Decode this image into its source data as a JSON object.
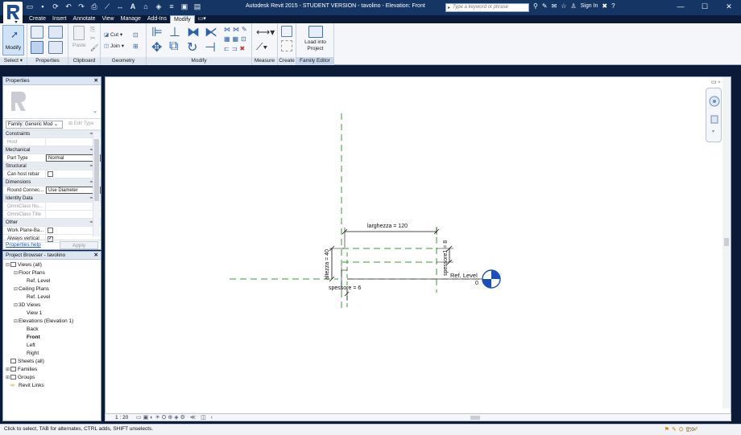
{
  "window": {
    "title": "Autodesk Revit 2015 - STUDENT VERSION -     tavolino - Elevation: Front",
    "search_placeholder": "Type a keyword or phrase",
    "signin_label": "Sign In",
    "controls": [
      "—",
      "☐",
      "✕"
    ]
  },
  "qat_icons": [
    "open-icon",
    "save-icon",
    "sync-icon",
    "undo-icon",
    "redo-icon",
    "print-icon",
    "measure-icon",
    "dimension-icon",
    "text-icon",
    "3d-view-icon",
    "section-icon",
    "thin-lines-icon",
    "close-hidden-icon",
    "switch-windows-icon"
  ],
  "ribbon": {
    "tabs": [
      "Create",
      "Insert",
      "Annotate",
      "View",
      "Manage",
      "Add-Ins",
      "Modify"
    ],
    "active_tab": "Modify",
    "modify_button": "Modify",
    "cut_label": "Cut",
    "join_label": "Join",
    "paste_label": "Paste",
    "load_into_project_label": "Load into Project",
    "panels": [
      "Select",
      "Properties",
      "Clipboard",
      "Geometry",
      "Modify",
      "Measure",
      "Create",
      "Family Editor"
    ]
  },
  "properties": {
    "title": "Properties",
    "family_select": "Family: Generic Mod",
    "edit_type_label": "Edit Type",
    "rows": [
      {
        "group": "Constraints"
      },
      {
        "k": "Host",
        "v": "",
        "dim": true
      },
      {
        "group": "Mechanical"
      },
      {
        "k": "Part Type",
        "v": "Normal"
      },
      {
        "group": "Structural"
      },
      {
        "k": "Can host rebar",
        "v": "",
        "check": true
      },
      {
        "group": "Dimensions"
      },
      {
        "k": "Round Connec...",
        "v": "Use Diameter"
      },
      {
        "group": "Identity Data"
      },
      {
        "k": "OmniClass Nu...",
        "v": "",
        "dim": true
      },
      {
        "k": "OmniClass Title",
        "v": "",
        "dim": true
      },
      {
        "group": "Other"
      },
      {
        "k": "Work Plane-Ba...",
        "v": "",
        "check": true
      },
      {
        "k": "Always vertical",
        "v": "",
        "check": true,
        "checked": true
      }
    ],
    "help_label": "Properties help",
    "apply_label": "Apply"
  },
  "project_browser": {
    "title": "Project Browser - tavolino",
    "nodes": [
      {
        "label": "Views (all)",
        "level": 0,
        "tog": "⊟",
        "icon": true
      },
      {
        "label": "Floor Plans",
        "level": 1,
        "tog": "⊟"
      },
      {
        "label": "Ref. Level",
        "level": 2
      },
      {
        "label": "Ceiling Plans",
        "level": 1,
        "tog": "⊟"
      },
      {
        "label": "Ref. Level",
        "level": 2
      },
      {
        "label": "3D Views",
        "level": 1,
        "tog": "⊟"
      },
      {
        "label": "View 1",
        "level": 2
      },
      {
        "label": "Elevations (Elevation 1)",
        "level": 1,
        "tog": "⊟"
      },
      {
        "label": "Back",
        "level": 2
      },
      {
        "label": "Front",
        "level": 2,
        "bold": true
      },
      {
        "label": "Left",
        "level": 2
      },
      {
        "label": "Right",
        "level": 2
      },
      {
        "label": "Sheets (all)",
        "level": 0,
        "icon": true
      },
      {
        "label": "Families",
        "level": 0,
        "tog": "⊞",
        "icon": true
      },
      {
        "label": "Groups",
        "level": 0,
        "tog": "⊞",
        "icon": true
      },
      {
        "label": "Revit Links",
        "level": 0,
        "link": true
      }
    ]
  },
  "drawing": {
    "dim_width": "larghezza = 120",
    "dim_height": "altezza = 40",
    "dim_thickness": "spessore = 6",
    "dim_thickness1": "spessore1 = 8",
    "ref_level": "Ref. Level",
    "ref_level_value": "0"
  },
  "view_control": {
    "scale": "1 : 20"
  },
  "status": {
    "text": "Click to select, TAB for alternates, CTRL adds, SHIFT unselects.",
    "filter": ":0"
  }
}
